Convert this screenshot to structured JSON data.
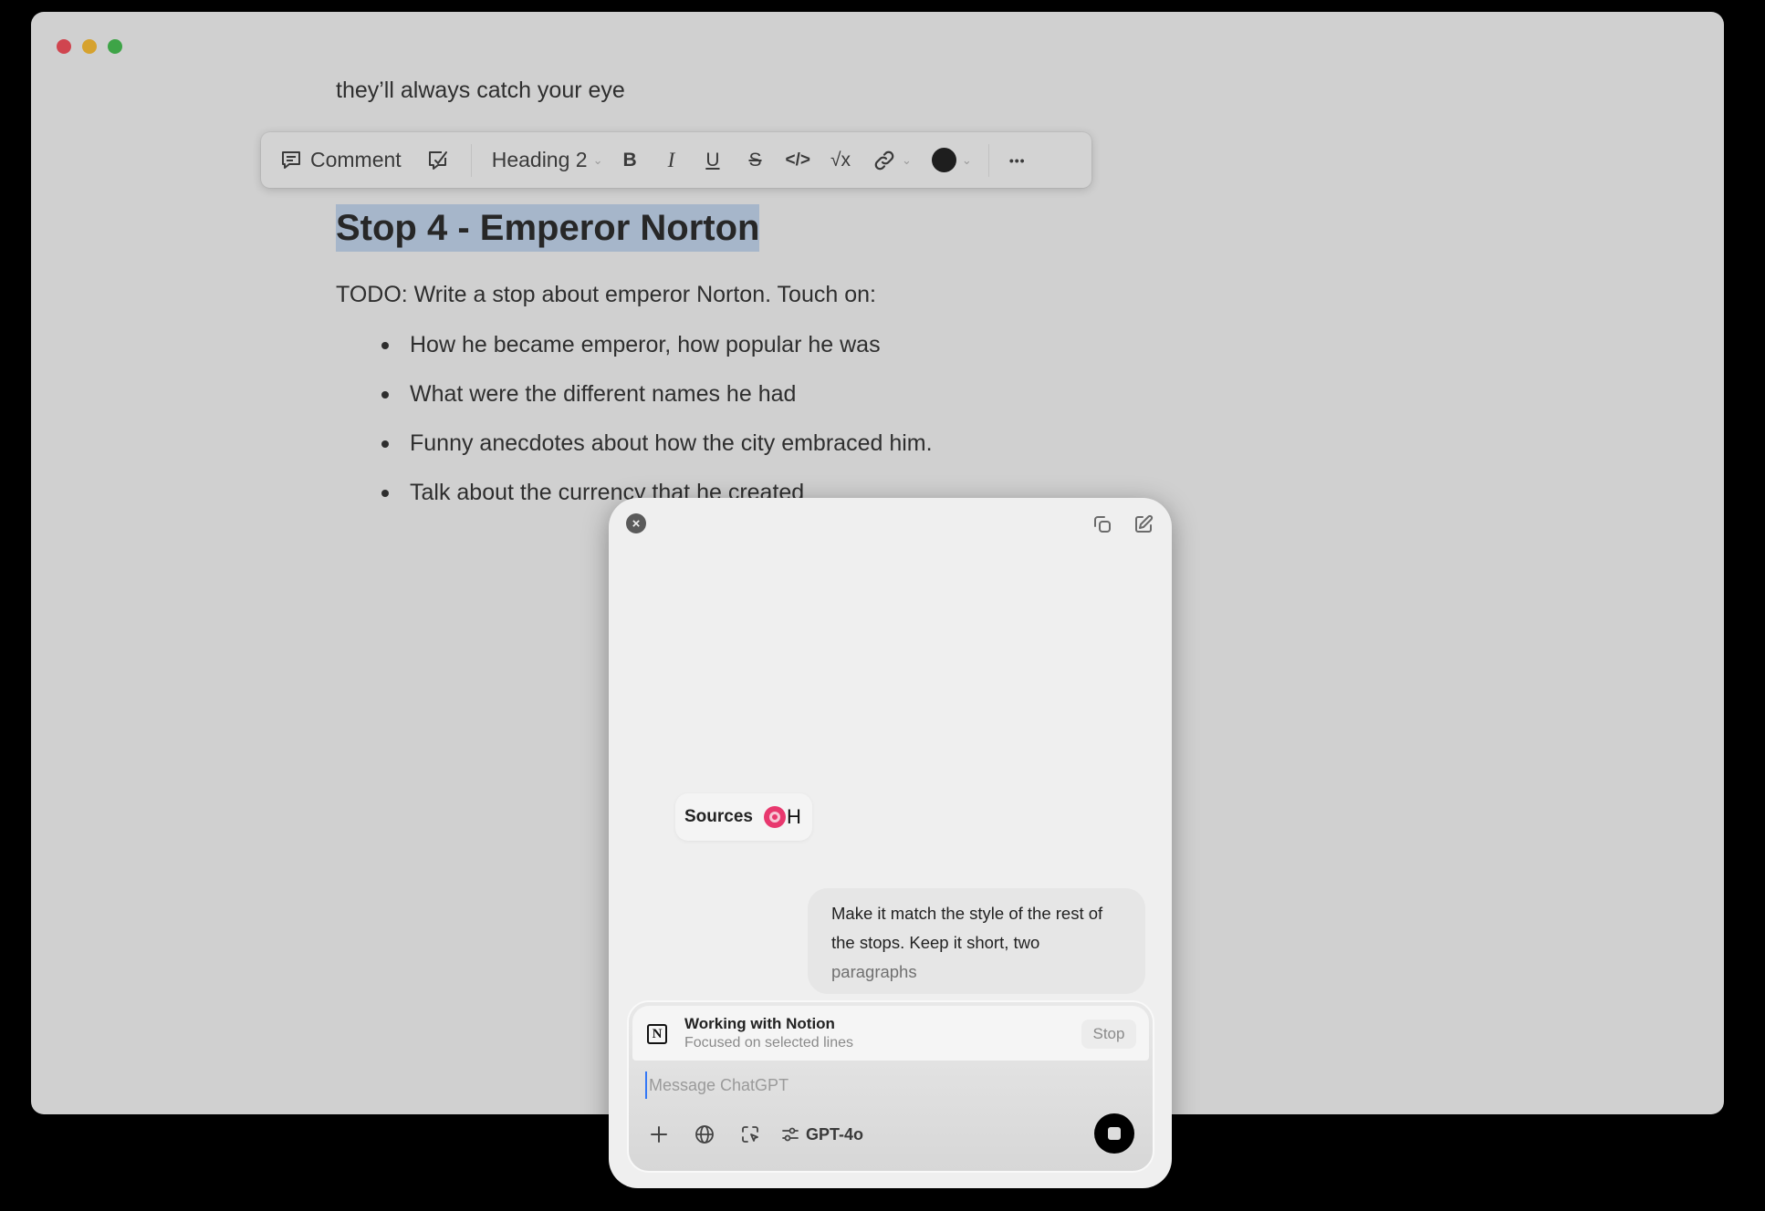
{
  "window": {
    "traffic_lights": {
      "close": "#d0454f",
      "minimize": "#d6a22e",
      "zoom": "#3ea447"
    }
  },
  "document": {
    "intro_text": "they’ll always catch your eye",
    "heading": "Stop 4 - Emperor Norton",
    "todo": "TODO: Write a stop about emperor Norton. Touch on:",
    "bullets": [
      "How he became emperor, how popular he was",
      "What were the different names he had",
      "Funny anecdotes about how the city embraced him.",
      "Talk about the currency that he created"
    ],
    "selection_color": "#a6b6ca"
  },
  "toolbar": {
    "comment_label": "Comment",
    "block_type": "Heading 2",
    "items": [
      "comment-icon",
      "ai-edit-icon",
      "bold-icon",
      "italic-icon",
      "underline-icon",
      "strikethrough-icon",
      "code-icon",
      "equation-icon",
      "link-icon",
      "text-color-icon",
      "more-icon"
    ],
    "bold_glyph": "B",
    "italic_glyph": "I",
    "underline_glyph": "U",
    "strike_glyph": "S",
    "code_glyph": "</>",
    "equation_glyph": "√x",
    "more_glyph": "•••",
    "text_color": "#1e1e1e"
  },
  "chat_panel": {
    "close_glyph": "×",
    "sources_label": "Sources",
    "sources_suffix": "H",
    "user_message_lines": [
      "Make it match the style of the rest of",
      "the stops. Keep it short, two",
      "paragraphs"
    ],
    "working": {
      "app_icon": "N",
      "title": "Working with Notion",
      "subtitle": "Focused on selected lines",
      "stop_label": "Stop"
    },
    "input": {
      "value": "",
      "placeholder": "Message ChatGPT"
    },
    "model_label": "GPT-4o",
    "accent_color": "#e8386e"
  }
}
